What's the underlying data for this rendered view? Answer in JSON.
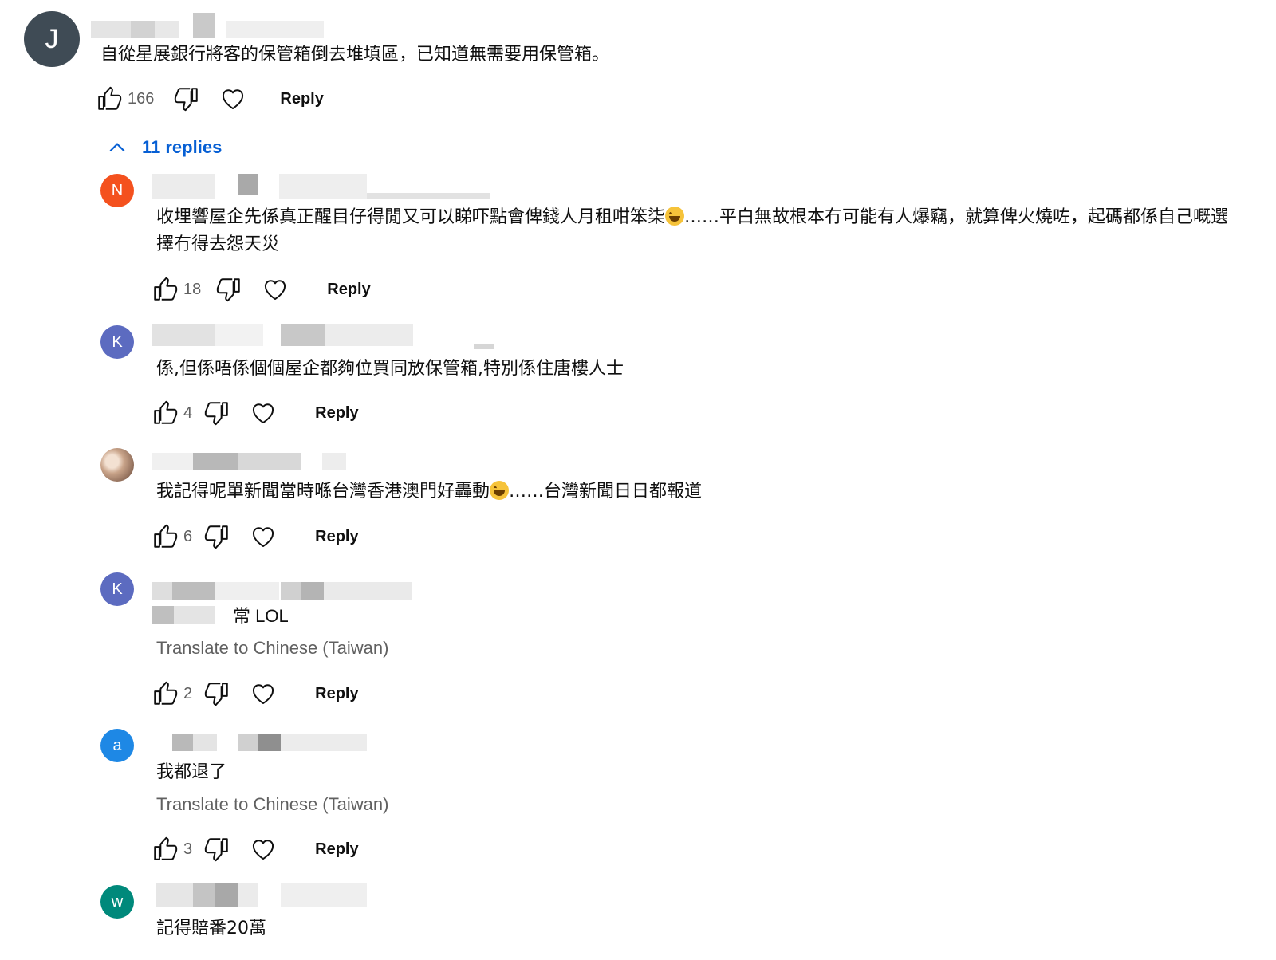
{
  "top_comment": {
    "avatar_letter": "J",
    "avatar_color": "#3f4b55",
    "text": "自從星展銀行將客的保管箱倒去堆填區，已知道無需要用保管箱。",
    "likes": "166",
    "reply_label": "Reply"
  },
  "replies_toggle": {
    "label": "11 replies",
    "icon": "chevron-up-icon"
  },
  "replies": [
    {
      "avatar_letter": "N",
      "avatar_color": "#f4511e",
      "text_part1": "收埋響屋企先係真正醒目仔得閒又可以睇吓點會俾錢人月租咁笨柒",
      "text_part2": "……平白無故根本冇可能有人爆竊，就算俾火燒咗，起碼都係自己嘅選擇冇得去怨天災",
      "likes": "18",
      "reply_label": "Reply"
    },
    {
      "avatar_letter": "K",
      "avatar_color": "#5c6bc0",
      "text": "係,但係唔係個個屋企都夠位買同放保管箱,特別係住唐樓人士",
      "likes": "4",
      "reply_label": "Reply"
    },
    {
      "avatar_letter": "",
      "avatar_color": "#c9a48a",
      "text_part1": "我記得呢單新聞當時喺台灣香港澳門好轟動",
      "text_part2": "……台灣新聞日日都報道",
      "likes": "6",
      "reply_label": "Reply"
    },
    {
      "avatar_letter": "K",
      "avatar_color": "#5c6bc0",
      "text": "常 LOL",
      "translate": "Translate to Chinese (Taiwan)",
      "likes": "2",
      "reply_label": "Reply"
    },
    {
      "avatar_letter": "a",
      "avatar_color": "#1e88e5",
      "text": "我都退了",
      "translate": "Translate to Chinese (Taiwan)",
      "likes": "3",
      "reply_label": "Reply"
    },
    {
      "avatar_letter": "w",
      "avatar_color": "#00897b",
      "text": "記得賠番20萬"
    }
  ],
  "icons": {
    "like": "thumbs-up-icon",
    "dislike": "thumbs-down-icon",
    "heart": "heart-icon"
  },
  "colors": {
    "link_blue": "#065fd4",
    "secondary_text": "#606060"
  }
}
